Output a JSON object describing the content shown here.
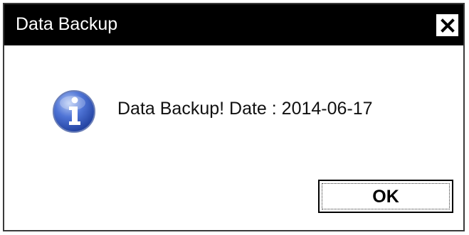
{
  "window": {
    "title": "Data Backup",
    "title_bar_color": "#000000",
    "close_icon": "close-icon"
  },
  "content": {
    "icon": "info-icon",
    "message": "Data Backup! Date : 2014-06-17"
  },
  "buttons": {
    "ok_label": "OK"
  }
}
